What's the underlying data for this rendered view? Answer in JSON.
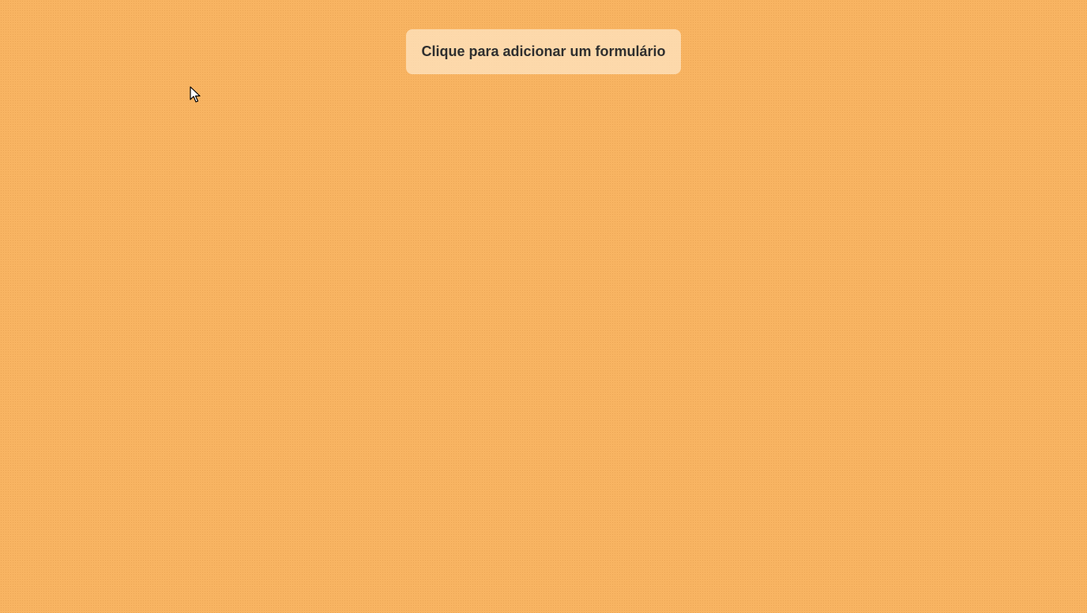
{
  "page": {
    "background_color": "#f8b462"
  },
  "main": {
    "add_form_button_label": "Clique para adicionar um formulário",
    "button_background": "#ffe8c8",
    "button_text_color": "#2f2f2f"
  },
  "pointer": {
    "icon": "mouse-pointer-icon"
  }
}
